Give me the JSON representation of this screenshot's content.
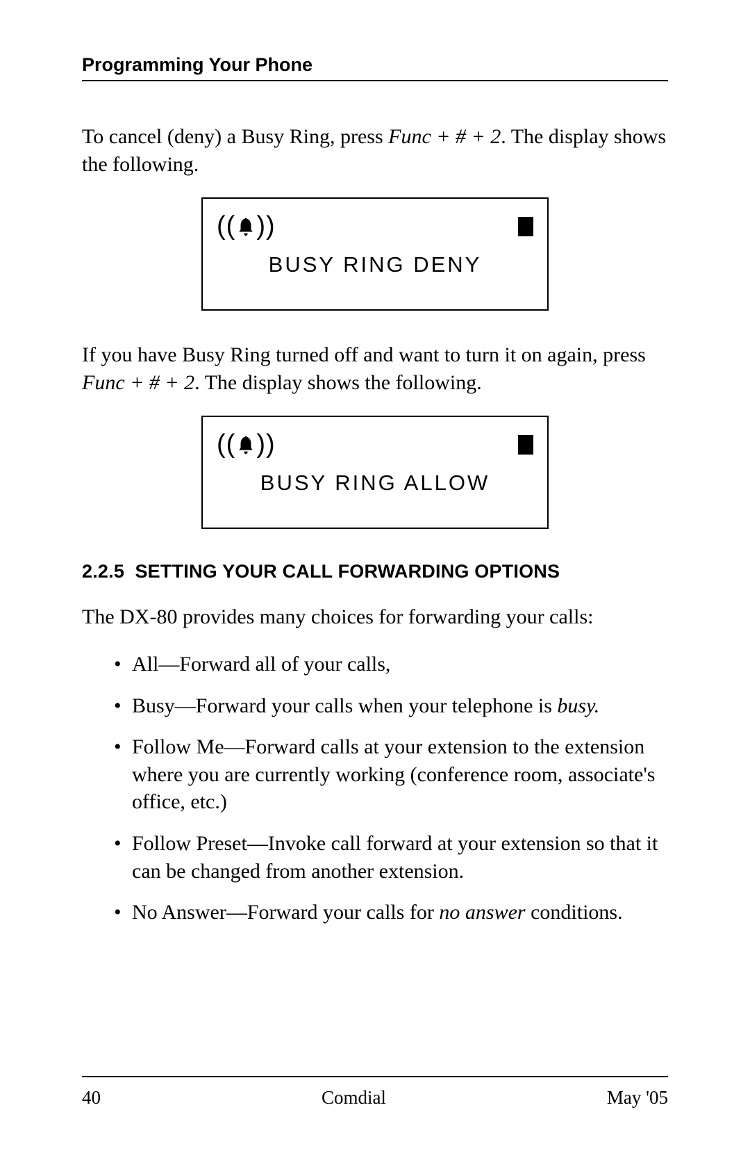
{
  "header": {
    "title": "Programming Your Phone"
  },
  "para1": {
    "pre": "To cancel (deny) a Busy Ring, press ",
    "keys": "Func + # + 2",
    "post": ".  The display shows the following."
  },
  "lcd1": {
    "text": "BUSY RING DENY"
  },
  "para2": {
    "pre": "If you have Busy Ring turned off and want to turn it on again, press ",
    "keys": "Func + # + 2",
    "post": ".  The display shows the following."
  },
  "lcd2": {
    "text": "BUSY RING ALLOW"
  },
  "section": {
    "number": "2.2.5",
    "title": "SETTING YOUR CALL FORWARDING OPTIONS"
  },
  "intro": "The DX-80 provides many choices for forwarding your calls:",
  "bullets": [
    {
      "text": "All—Forward all of your calls,"
    },
    {
      "pre": "Busy—Forward your calls when your telephone is ",
      "em": "busy."
    },
    {
      "text": "Follow Me—Forward calls at your extension to the extension where you are currently working (conference room, associate's office, etc.)"
    },
    {
      "text": "Follow Preset—Invoke call forward at your extension so that it can be changed from another extension."
    },
    {
      "pre": "No Answer—Forward your calls for ",
      "em": "no answer",
      "post": " conditions."
    }
  ],
  "footer": {
    "page": "40",
    "center": "Comdial",
    "date": "May '05"
  }
}
